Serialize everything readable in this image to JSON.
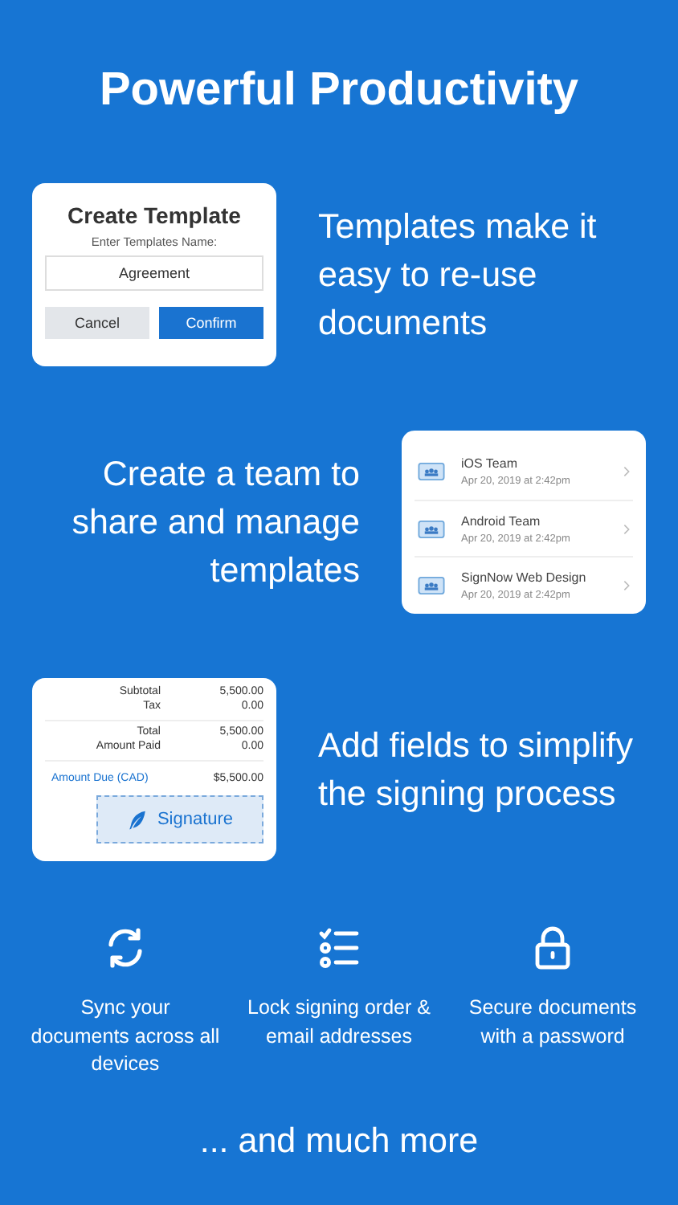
{
  "title": "Powerful Productivity",
  "sections": [
    {
      "kind": "template",
      "text": "Templates make it easy to re-use documents",
      "dialog": {
        "title": "Create Template",
        "label": "Enter Templates Name:",
        "value": "Agreement",
        "cancel": "Cancel",
        "confirm": "Confirm"
      }
    },
    {
      "kind": "teams",
      "text": "Create a team to share and manage templates",
      "teams": [
        {
          "name": "iOS Team",
          "date": "Apr 20, 2019 at 2:42pm"
        },
        {
          "name": "Android Team",
          "date": "Apr 20, 2019 at 2:42pm"
        },
        {
          "name": "SignNow Web Design",
          "date": "Apr 20, 2019 at 2:42pm"
        }
      ]
    },
    {
      "kind": "invoice",
      "text": "Add fields to simplify the signing process",
      "groups": [
        [
          {
            "label": "Subtotal",
            "value": "5,500.00"
          },
          {
            "label": "Tax",
            "value": "0.00"
          }
        ],
        [
          {
            "label": "Total",
            "value": "5,500.00"
          },
          {
            "label": "Amount Paid",
            "value": "0.00"
          }
        ]
      ],
      "due": {
        "label": "Amount Due (CAD)",
        "value": "$5,500.00"
      },
      "signature": "Signature"
    }
  ],
  "features": [
    {
      "kind": "sync",
      "text": "Sync your documents across all devices"
    },
    {
      "kind": "list",
      "text": "Lock signing order & email addresses"
    },
    {
      "kind": "lock",
      "text": "Secure documents with a password"
    }
  ],
  "footer": "... and much more"
}
